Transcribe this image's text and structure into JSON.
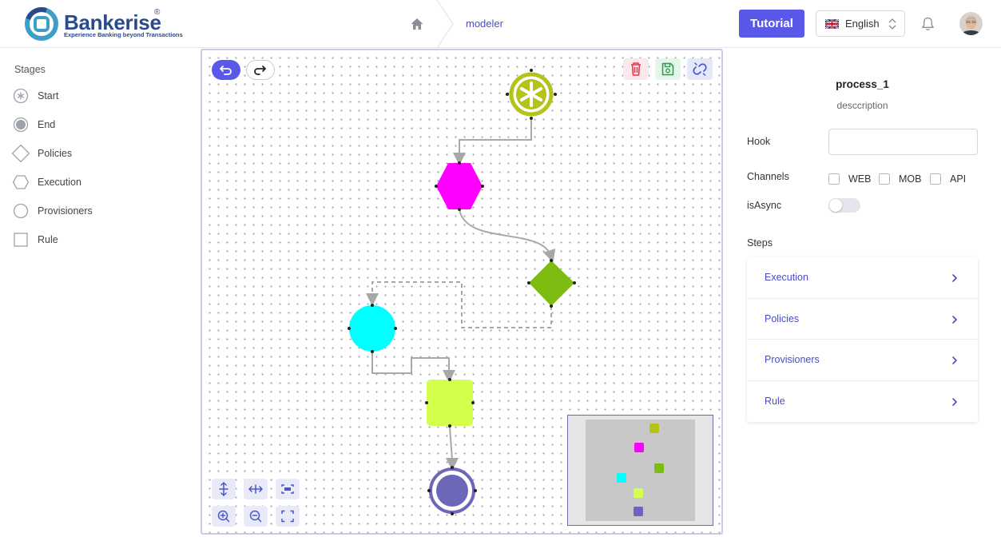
{
  "brand": {
    "name": "Bankerise",
    "registered": "®",
    "tagline": "Experience Banking beyond Transactions"
  },
  "breadcrumb": {
    "current": "modeler"
  },
  "header": {
    "tutorial_label": "Tutorial",
    "language": "English"
  },
  "stages": {
    "title": "Stages",
    "items": [
      {
        "label": "Start",
        "icon": "asterisk-circle-icon"
      },
      {
        "label": "End",
        "icon": "filled-circle-icon"
      },
      {
        "label": "Policies",
        "icon": "diamond-icon"
      },
      {
        "label": "Execution",
        "icon": "hexagon-icon"
      },
      {
        "label": "Provisioners",
        "icon": "circle-icon"
      },
      {
        "label": "Rule",
        "icon": "square-icon"
      }
    ]
  },
  "canvas": {
    "node_colors": {
      "start": "#b5c21a",
      "execution": "#ff00ff",
      "policy": "#7dbd12",
      "provisioner": "#00ffff",
      "rule": "#d3ff4d",
      "end": "#6c67b8"
    }
  },
  "properties": {
    "process_name": "process_1",
    "description": "desccription",
    "hook_label": "Hook",
    "hook_value": "",
    "channels_label": "Channels",
    "channels": [
      {
        "label": "WEB",
        "checked": false
      },
      {
        "label": "MOB",
        "checked": false
      },
      {
        "label": "API",
        "checked": false
      }
    ],
    "async_label": "isAsync",
    "async_on": false,
    "steps_title": "Steps",
    "steps": [
      {
        "label": "Execution"
      },
      {
        "label": "Policies"
      },
      {
        "label": "Provisioners"
      },
      {
        "label": "Rule"
      }
    ]
  },
  "colors": {
    "accent": "#5a58e8",
    "link": "#4b4cc9"
  }
}
